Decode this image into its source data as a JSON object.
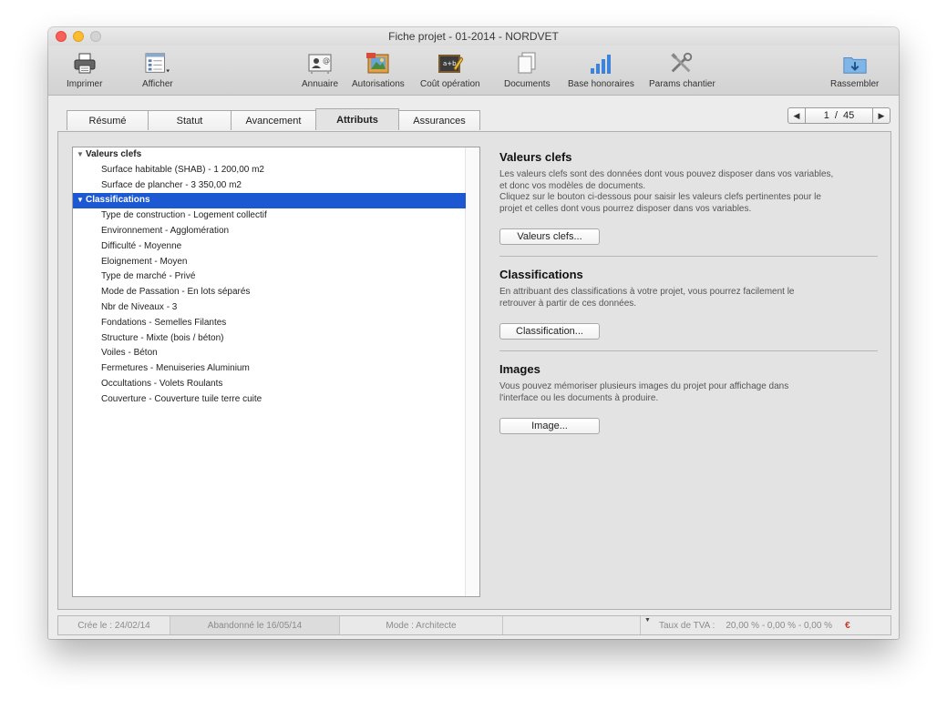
{
  "window": {
    "title": "Fiche projet - 01-2014 - NORDVET"
  },
  "toolbar": {
    "imprimer": "Imprimer",
    "afficher": "Afficher",
    "annuaire": "Annuaire",
    "autorisations": "Autorisations",
    "cout": "Coût opération",
    "documents": "Documents",
    "base": "Base honoraires",
    "params": "Params chantier",
    "rassembler": "Rassembler"
  },
  "tabs": [
    "Résumé",
    "Statut",
    "Avancement",
    "Attributs",
    "Assurances"
  ],
  "pager": {
    "prev": "◀",
    "current": "1",
    "separator": "/",
    "total": "45",
    "next": "▶"
  },
  "tree": {
    "groups": [
      {
        "label": "Valeurs clefs",
        "items": [
          "Surface habitable (SHAB) - 1 200,00 m2",
          "Surface de plancher - 3 350,00 m2"
        ]
      },
      {
        "label": "Classifications",
        "items": [
          "Type de construction - Logement collectif",
          "Environnement - Agglomération",
          "Difficulté - Moyenne",
          "Eloignement - Moyen",
          "Type de marché - Privé",
          "Mode de Passation - En lots séparés",
          "Nbr de Niveaux - 3",
          "Fondations - Semelles Filantes",
          "Structure - Mixte (bois / béton)",
          "Voiles - Béton",
          "Fermetures - Menuiseries Aluminium",
          "Occultations - Volets Roulants",
          "Couverture - Couverture tuile terre cuite"
        ]
      }
    ]
  },
  "sections": {
    "valeurs": {
      "title": "Valeurs clefs",
      "text1": "Les valeurs clefs sont des données dont vous pouvez disposer dans vos variables,",
      "text2": "et donc vos modèles de documents.",
      "text3": "Cliquez sur le bouton ci-dessous pour saisir les valeurs clefs pertinentes pour le",
      "text4": "projet et celles dont vous pourrez disposer dans vos variables.",
      "button": "Valeurs clefs..."
    },
    "classifications": {
      "title": "Classifications",
      "text1": "En attribuant des classifications à votre projet, vous pourrez facilement le",
      "text2": "retrouver à partir de ces données.",
      "button": "Classification..."
    },
    "images": {
      "title": "Images",
      "text1": "Vous pouvez mémoriser plusieurs images du projet pour affichage dans",
      "text2": "l'interface ou les documents à produire.",
      "button": "Image..."
    }
  },
  "status": {
    "created": "Crée le : 24/02/14",
    "abandoned": "Abandonné le 16/05/14",
    "mode": "Mode : Architecte",
    "tva_label": "Taux de TVA :",
    "tva_value": "20,00 % - 0,00 % - 0,00 %",
    "currency": "€"
  },
  "colors": {
    "selection": "#1b58d2",
    "currency": "#c0392b"
  }
}
